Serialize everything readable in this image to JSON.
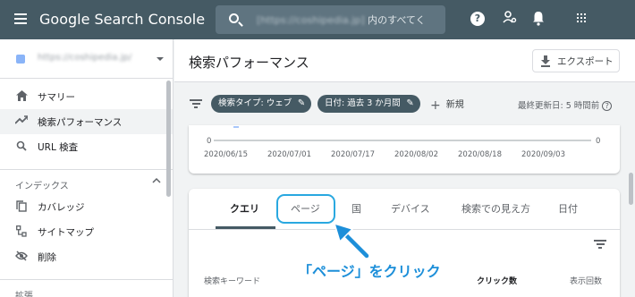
{
  "topbar": {
    "app_title": "Google Search Console",
    "search_placeholder_site": "[https://coshipedia.jp]",
    "search_placeholder_suffix": " 内のすべてく",
    "help_glyph": "?"
  },
  "sidebar": {
    "property_name": "https://coshipedia.jp/",
    "items": [
      {
        "label": "サマリー",
        "icon": "home-icon"
      },
      {
        "label": "検索パフォーマンス",
        "icon": "trending-icon"
      },
      {
        "label": "URL 検査",
        "icon": "search-icon"
      }
    ],
    "index_header": "インデックス",
    "index_items": [
      {
        "label": "カバレッジ",
        "icon": "copy-icon"
      },
      {
        "label": "サイトマップ",
        "icon": "sitemap-icon"
      },
      {
        "label": "削除",
        "icon": "eye-off-icon"
      }
    ],
    "enhance_header": "拡張"
  },
  "header": {
    "title": "検索パフォーマンス",
    "export_label": "エクスポート"
  },
  "filters": {
    "chip_type": "検索タイプ: ウェブ",
    "chip_date": "日付: 過去 3 か月間",
    "add_label": "新規",
    "updated": "最終更新日: 5 時間前"
  },
  "chart_data": {
    "type": "line",
    "x": [
      "2020/06/15",
      "2020/07/01",
      "2020/07/17",
      "2020/08/02",
      "2020/08/18",
      "2020/09/03"
    ],
    "y_tick": "0",
    "y_tick_right": "0"
  },
  "table": {
    "tabs": [
      "クエリ",
      "ページ",
      "国",
      "デバイス",
      "検索での見え方",
      "日付"
    ],
    "columns": [
      "検索キーワード",
      "クリック数",
      "表示回数"
    ]
  },
  "annotation": "「ページ」をクリック",
  "colors": {
    "topbar": "#455a64",
    "highlight": "#29a8e0",
    "annotation": "#1d8fd9"
  }
}
